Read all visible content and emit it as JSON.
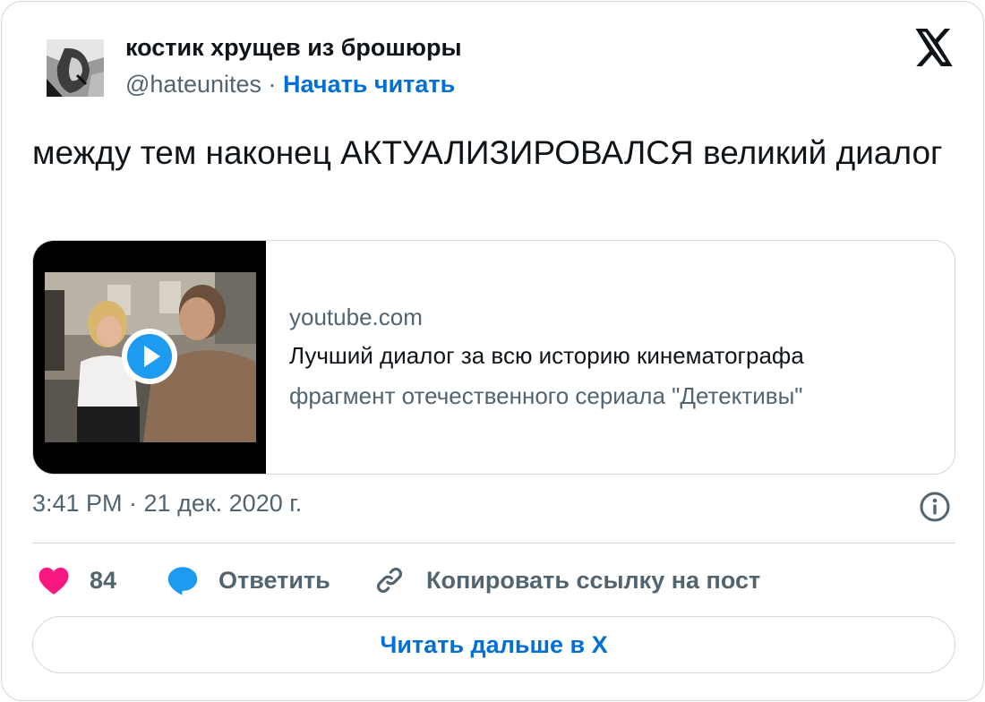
{
  "author": {
    "name": "костик хрущев из брошюры",
    "handle": "@hateunites",
    "separator": "·",
    "follow_label": "Начать читать"
  },
  "tweet": {
    "text": "между тем наконец АКТУАЛИЗИРОВАЛСЯ великий диалог"
  },
  "link_card": {
    "domain": "youtube.com",
    "title": "Лучший диалог за всю историю кинематографа",
    "description": "фрагмент отечественного сериала \"Детективы\""
  },
  "timestamp": "3:41 PM · 21 дек. 2020 г.",
  "actions": {
    "like_count": "84",
    "reply_label": "Ответить",
    "copy_link_label": "Копировать ссылку на пост"
  },
  "read_more_label": "Читать дальше в X",
  "icons": {
    "logo": "x-logo-icon",
    "info": "info-icon",
    "like": "heart-icon",
    "reply": "speech-bubble-icon",
    "copy": "link-icon",
    "play": "play-icon"
  },
  "colors": {
    "accent": "#006fd6",
    "like": "#f91880",
    "reply": "#1d9bf0",
    "muted": "#536471",
    "border": "#cfd9de"
  }
}
